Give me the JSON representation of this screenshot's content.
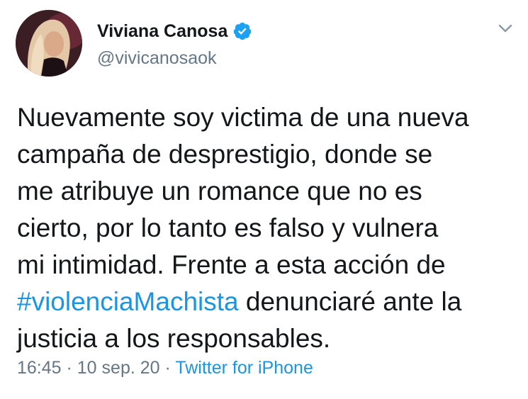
{
  "user": {
    "display_name": "Viviana Canosa",
    "handle": "@vivicanosaok",
    "verified": true
  },
  "icons": {
    "verified": "verified-badge-icon",
    "menu": "chevron-down-icon"
  },
  "tweet": {
    "line1": "Nuevamente soy victima de una nueva",
    "line2": "campaña de desprestigio, donde se",
    "line3": "me atribuye un romance que no es",
    "line4": "cierto, por lo tanto es falso y vulnera",
    "line5": "mi intimidad. Frente a esta acción de",
    "hashtag": "#violenciaMachista",
    "line6_rest": " denunciaré ante la",
    "line7": "justicia a los responsables."
  },
  "meta": {
    "time": "16:45",
    "sep1": " · ",
    "date": "10 sep. 20",
    "sep2": " · ",
    "source": "Twitter for iPhone"
  },
  "colors": {
    "text": "#14171a",
    "secondary": "#657786",
    "link": "#1b95e0",
    "verified": "#1da1f2"
  }
}
